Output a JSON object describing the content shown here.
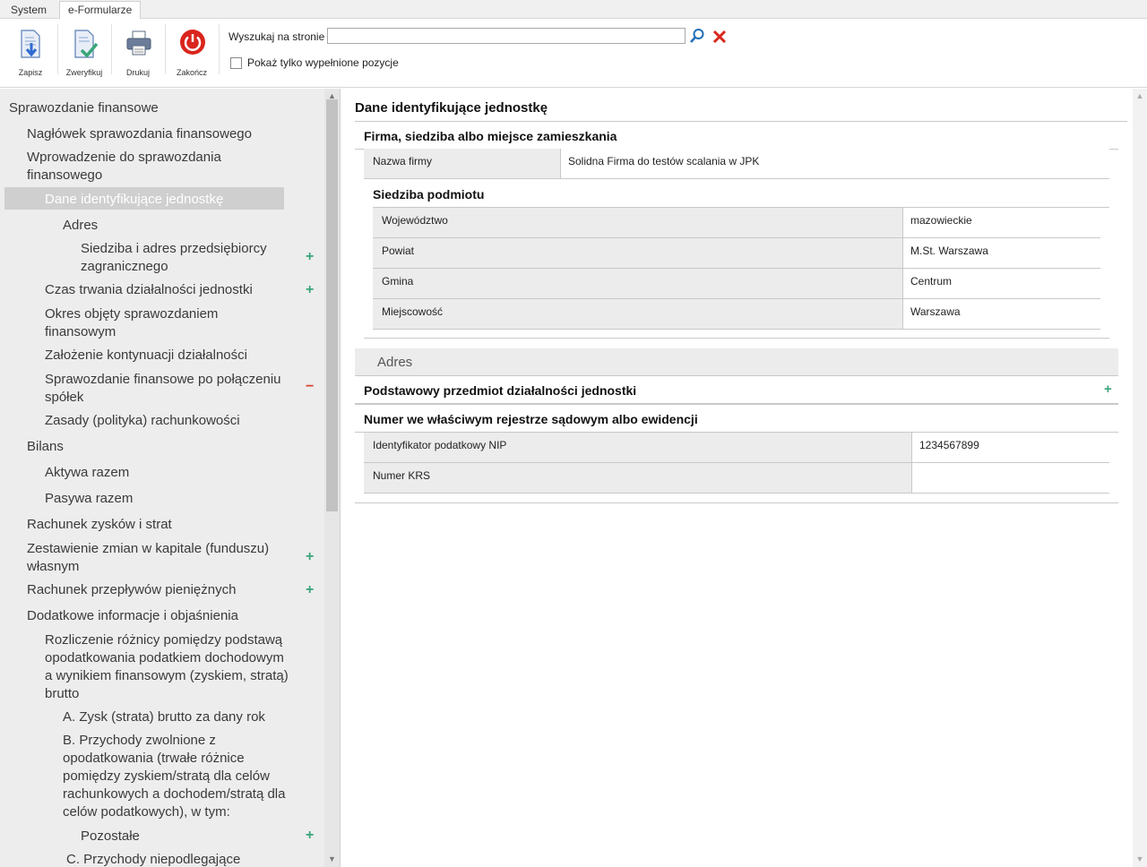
{
  "tabs": [
    "System",
    "e-Formularze"
  ],
  "toolbar": {
    "save_label": "Zapisz",
    "verify_label": "Zweryfikuj",
    "print_label": "Drukuj",
    "exit_label": "Zakończ",
    "search_label": "Wyszukaj na stronie",
    "search_value": "",
    "filled_only_label": "Pokaż tylko wypełnione pozycje"
  },
  "icons": {
    "save": "save-down-arrow-icon",
    "verify": "document-check-icon",
    "print": "printer-icon",
    "exit": "power-icon",
    "search": "magnifier-icon",
    "clear": "red-x-icon",
    "plus": "+",
    "minus": "−"
  },
  "colors": {
    "plus": "#3aa57a",
    "minus": "#d9432e",
    "exit_red": "#d9261c",
    "selected_row": "#cfcfcf"
  },
  "tree": {
    "items": [
      {
        "label": "Sprawozdanie finansowe",
        "level": 0
      },
      {
        "label": "Nagłówek sprawozdania finansowego",
        "level": 1
      },
      {
        "label": "Wprowadzenie do sprawozdania finansowego",
        "level": 1
      },
      {
        "label": "Dane identyfikujące jednostkę",
        "level": 2,
        "selected": true
      },
      {
        "label": "Adres",
        "level": 3
      },
      {
        "label": "Siedziba i adres przedsiębiorcy zagranicznego",
        "level": 4,
        "action": "plus"
      },
      {
        "label": "Czas trwania działalności jednostki",
        "level": 2,
        "action": "plus"
      },
      {
        "label": "Okres objęty sprawozdaniem finansowym",
        "level": 2
      },
      {
        "label": "Założenie kontynuacji działalności",
        "level": 2
      },
      {
        "label": "Sprawozdanie finansowe po połączeniu spółek",
        "level": 2,
        "action": "minus"
      },
      {
        "label": "Zasady (polityka) rachunkowości",
        "level": 2
      },
      {
        "label": "Bilans",
        "level": 1
      },
      {
        "label": "Aktywa razem",
        "level": 2
      },
      {
        "label": "Pasywa razem",
        "level": 2
      },
      {
        "label": "Rachunek zysków i strat",
        "level": 1
      },
      {
        "label": "Zestawienie zmian w kapitale (funduszu) własnym",
        "level": 1,
        "action": "plus"
      },
      {
        "label": "Rachunek przepływów pieniężnych",
        "level": 1,
        "action": "plus"
      },
      {
        "label": "Dodatkowe informacje i objaśnienia",
        "level": 1
      },
      {
        "label": "Rozliczenie różnicy pomiędzy podstawą opodatkowania podatkiem dochodowym a wynikiem finansowym (zyskiem, stratą) brutto",
        "level": 2
      },
      {
        "label": "A. Zysk (strata) brutto za dany rok",
        "level": 3
      },
      {
        "label": "B. Przychody zwolnione z opodatkowania (trwałe różnice pomiędzy zyskiem/stratą dla celów rachunkowych a dochodem/stratą dla celów podatkowych), w tym:",
        "level": 3
      },
      {
        "label": "Pozostałe",
        "level": 4,
        "action": "plus"
      },
      {
        "label": "C. Przychody niepodlegające",
        "level": 3
      }
    ]
  },
  "form": {
    "title": "Dane identyfikujące jednostkę",
    "section1": {
      "title": "Firma, siedziba albo miejsce zamieszkania",
      "name_label": "Nazwa firmy",
      "name_value": "Solidna Firma do testów scalania w JPK",
      "seat_title": "Siedziba podmiotu",
      "rows": [
        {
          "label": "Województwo",
          "value": "mazowieckie"
        },
        {
          "label": "Powiat",
          "value": "M.St. Warszawa"
        },
        {
          "label": "Gmina",
          "value": "Centrum"
        },
        {
          "label": "Miejscowość",
          "value": "Warszawa"
        }
      ]
    },
    "address_label": "Adres",
    "section2_title": "Podstawowy przedmiot działalności jednostki",
    "section3": {
      "title": "Numer we właściwym rejestrze sądowym albo ewidencji",
      "rows": [
        {
          "label": "Identyfikator podatkowy NIP",
          "value": "1234567899"
        },
        {
          "label": "Numer KRS",
          "value": ""
        }
      ]
    }
  }
}
